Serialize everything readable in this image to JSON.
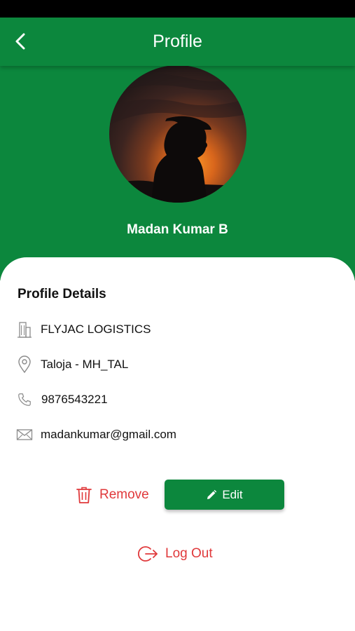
{
  "app_bar": {
    "title": "Profile",
    "back_icon": "chevron-left-icon"
  },
  "profile": {
    "name": "Madan Kumar B",
    "avatar": "silhouette-sunset-photo"
  },
  "details": {
    "heading": "Profile Details",
    "company": "FLYJAC LOGISTICS",
    "location": "Taloja - MH_TAL",
    "phone": "9876543221",
    "email": "madankumar@gmail.com"
  },
  "actions": {
    "remove_label": "Remove",
    "edit_label": "Edit",
    "logout_label": "Log Out"
  },
  "colors": {
    "primary_green": "#0c873d",
    "danger_red": "#e0393b"
  }
}
